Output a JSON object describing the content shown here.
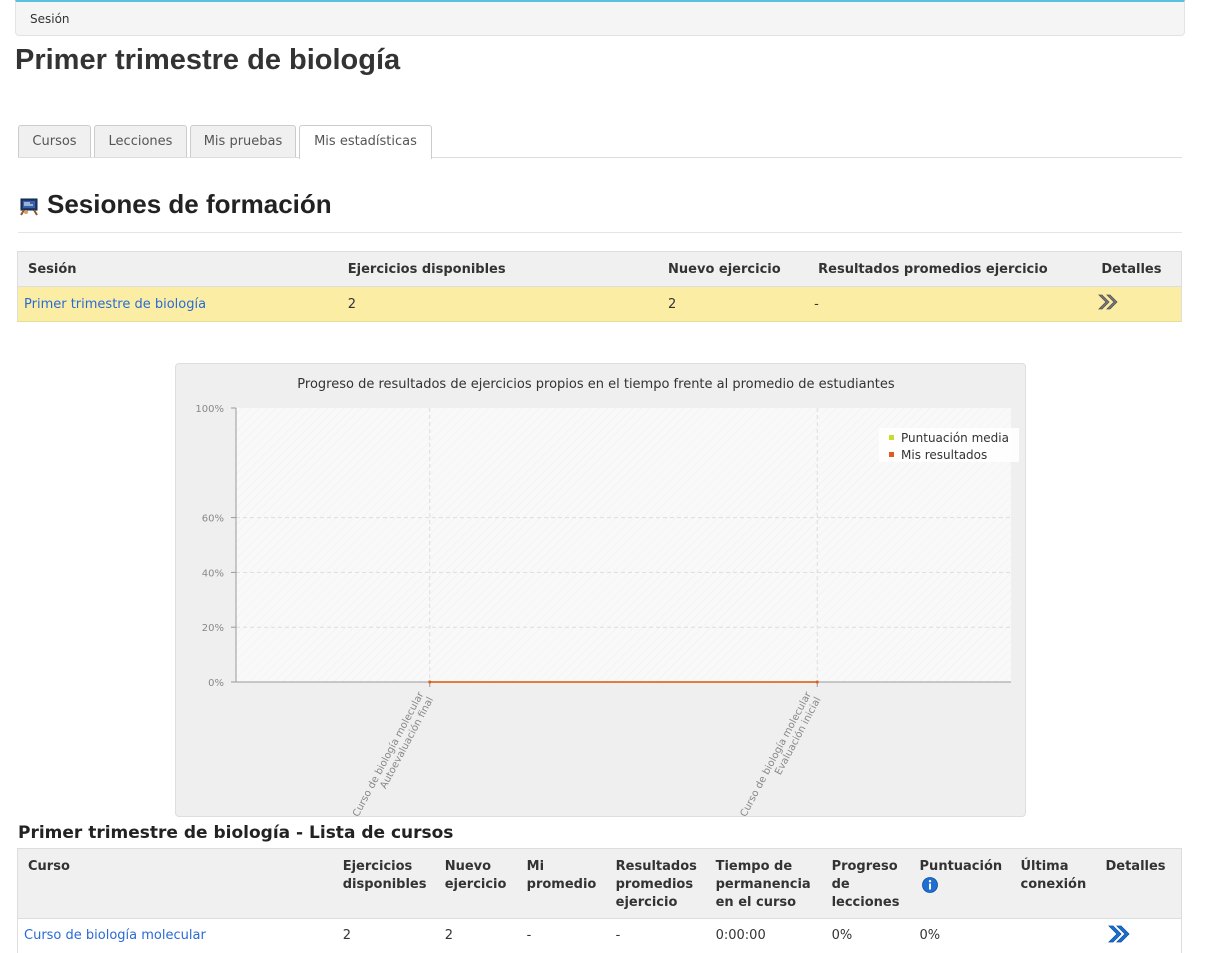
{
  "breadcrumb": {
    "current": "Sesión"
  },
  "page": {
    "title": "Primer trimestre de biología"
  },
  "tabs": [
    {
      "label": "Cursos",
      "active": false
    },
    {
      "label": "Lecciones",
      "active": false
    },
    {
      "label": "Mis pruebas",
      "active": false
    },
    {
      "label": "Mis estadísticas",
      "active": true
    }
  ],
  "section": {
    "title": "Sesiones de formación",
    "icon": "training-session-icon"
  },
  "sessions_table": {
    "headers": [
      "Sesión",
      "Ejercicios disponibles",
      "Nuevo ejercicio",
      "Resultados promedios ejercicio",
      "Detalles"
    ],
    "rows": [
      {
        "session": "Primer trimestre de biología",
        "available": "2",
        "new": "2",
        "average": "-",
        "details_icon": "double-chevron-right-icon"
      }
    ]
  },
  "chart_data": {
    "type": "line",
    "title": "Progreso de resultados de ejercicios propios en el tiempo frente al promedio de estudiantes",
    "xlabel": "",
    "ylabel": "",
    "categories": [
      [
        "Curso de biología molecular",
        "Autoevaluación final"
      ],
      [
        "Curso de biología molecular",
        "Evaluación inicial"
      ]
    ],
    "y_ticks": [
      "100%",
      "60%",
      "40%",
      "20%",
      "0%"
    ],
    "ylim": [
      0,
      100
    ],
    "grid": true,
    "legend_position": "top-right",
    "series": [
      {
        "name": "Puntuación media",
        "color": "#c7dc2e",
        "values": [
          0,
          0
        ]
      },
      {
        "name": "Mis resultados",
        "color": "#e05b23",
        "values": [
          0,
          0
        ]
      }
    ]
  },
  "courses": {
    "title": "Primer trimestre de biología - Lista de cursos",
    "headers": [
      {
        "label": "Curso"
      },
      {
        "label": "Ejercicios disponibles"
      },
      {
        "label": "Nuevo ejercicio"
      },
      {
        "label": "Mi promedio"
      },
      {
        "label": "Resultados promedios ejercicio"
      },
      {
        "label": "Tiempo de permanencia en el curso"
      },
      {
        "label": "Progreso de lecciones"
      },
      {
        "label": "Puntuación",
        "icon": "info-icon"
      },
      {
        "label": "Última conexión"
      },
      {
        "label": "Detalles"
      }
    ],
    "rows": [
      {
        "course": "Curso de biología molecular",
        "available": "2",
        "new": "2",
        "my_average": "-",
        "average": "-",
        "time": "0:00:00",
        "progress": "0%",
        "score": "0%",
        "last_connection": "",
        "details_icon": "double-chevron-right-icon"
      }
    ]
  },
  "colors": {
    "highlight_row": "#fbeea4",
    "link": "#2a6ad6",
    "details_icon": "#1b6fd1"
  }
}
